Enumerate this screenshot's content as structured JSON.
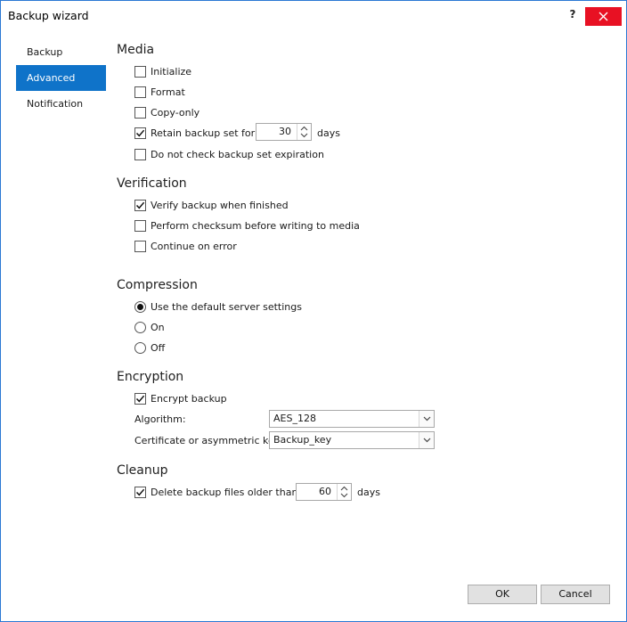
{
  "window": {
    "title": "Backup wizard",
    "help_label": "?",
    "close_icon": "close-icon",
    "accent_color": "#0f73c9",
    "close_color": "#e81123"
  },
  "nav": {
    "items": [
      {
        "label": "Backup",
        "active": false
      },
      {
        "label": "Advanced",
        "active": true
      },
      {
        "label": "Notification",
        "active": false
      }
    ]
  },
  "media": {
    "title": "Media",
    "initialize": {
      "label": "Initialize",
      "checked": false
    },
    "format": {
      "label": "Format",
      "checked": false
    },
    "copy_only": {
      "label": "Copy-only",
      "checked": false
    },
    "retain": {
      "label": "Retain backup set for",
      "checked": true,
      "value": "30",
      "suffix": "days"
    },
    "no_expiration_check": {
      "label": "Do not check backup set expiration",
      "checked": false
    }
  },
  "verification": {
    "title": "Verification",
    "verify": {
      "label": "Verify backup when finished",
      "checked": true
    },
    "checksum": {
      "label": "Perform checksum before writing to media",
      "checked": false
    },
    "continue_on_error": {
      "label": "Continue on error",
      "checked": false
    }
  },
  "compression": {
    "title": "Compression",
    "options": [
      {
        "label": "Use the default server settings",
        "selected": true
      },
      {
        "label": "On",
        "selected": false
      },
      {
        "label": "Off",
        "selected": false
      }
    ]
  },
  "encryption": {
    "title": "Encryption",
    "encrypt": {
      "label": "Encrypt backup",
      "checked": true
    },
    "algorithm_label": "Algorithm:",
    "algorithm_value": "AES_128",
    "key_label": "Certificate or asymmetric key:",
    "key_value": "Backup_key"
  },
  "cleanup": {
    "title": "Cleanup",
    "delete_older": {
      "label": "Delete backup files older than",
      "checked": true,
      "value": "60",
      "suffix": "days"
    }
  },
  "footer": {
    "ok_label": "OK",
    "cancel_label": "Cancel"
  }
}
